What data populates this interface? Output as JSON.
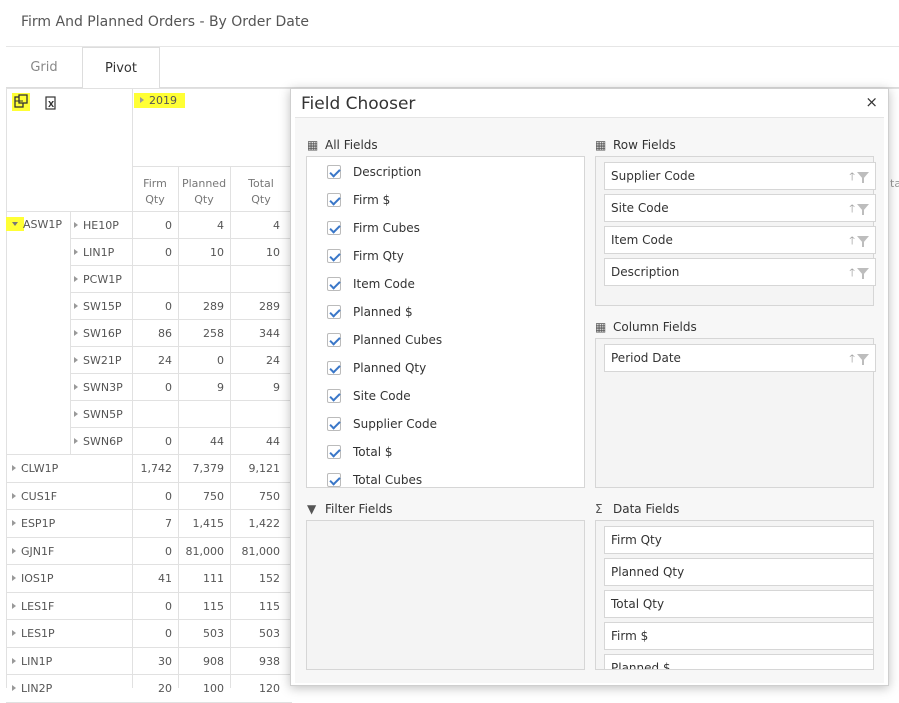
{
  "page": {
    "title": "Firm And Planned Orders - By Order Date"
  },
  "tabs": [
    {
      "label": "Grid"
    },
    {
      "label": "Pivot"
    }
  ],
  "pivot": {
    "year": "2019",
    "col_headers": [
      "Firm\nQty",
      "Planned\nQty",
      "Total\nQty"
    ],
    "col_partial": "ta",
    "group": "ASW1P",
    "sub_rows": [
      {
        "label": "HE10P",
        "firm": "0",
        "planned": "4",
        "total": "4"
      },
      {
        "label": "LIN1P",
        "firm": "0",
        "planned": "10",
        "total": "10"
      },
      {
        "label": "PCW1P",
        "firm": "",
        "planned": "",
        "total": ""
      },
      {
        "label": "SW15P",
        "firm": "0",
        "planned": "289",
        "total": "289"
      },
      {
        "label": "SW16P",
        "firm": "86",
        "planned": "258",
        "total": "344"
      },
      {
        "label": "SW21P",
        "firm": "24",
        "planned": "0",
        "total": "24"
      },
      {
        "label": "SWN3P",
        "firm": "0",
        "planned": "9",
        "total": "9"
      },
      {
        "label": "SWN5P",
        "firm": "",
        "planned": "",
        "total": ""
      },
      {
        "label": "SWN6P",
        "firm": "0",
        "planned": "44",
        "total": "44"
      }
    ],
    "rows": [
      {
        "label": "CLW1P",
        "firm": "1,742",
        "planned": "7,379",
        "total": "9,121"
      },
      {
        "label": "CUS1F",
        "firm": "0",
        "planned": "750",
        "total": "750"
      },
      {
        "label": "ESP1P",
        "firm": "7",
        "planned": "1,415",
        "total": "1,422"
      },
      {
        "label": "GJN1F",
        "firm": "0",
        "planned": "81,000",
        "total": "81,000"
      },
      {
        "label": "IOS1P",
        "firm": "41",
        "planned": "111",
        "total": "152"
      },
      {
        "label": "LES1F",
        "firm": "0",
        "planned": "115",
        "total": "115"
      },
      {
        "label": "LES1P",
        "firm": "0",
        "planned": "503",
        "total": "503"
      },
      {
        "label": "LIN1P",
        "firm": "30",
        "planned": "908",
        "total": "938"
      },
      {
        "label": "LIN2P",
        "firm": "20",
        "planned": "100",
        "total": "120"
      }
    ]
  },
  "dialog": {
    "title": "Field Chooser",
    "close": "×",
    "all_fields_label": "All Fields",
    "all_fields": [
      "Description",
      "Firm $",
      "Firm Cubes",
      "Firm Qty",
      "Item Code",
      "Planned $",
      "Planned Cubes",
      "Planned Qty",
      "Site Code",
      "Supplier Code",
      "Total $",
      "Total Cubes"
    ],
    "row_fields_label": "Row Fields",
    "row_fields": [
      "Supplier Code",
      "Site Code",
      "Item Code",
      "Description"
    ],
    "column_fields_label": "Column Fields",
    "column_fields": [
      "Period Date"
    ],
    "filter_fields_label": "Filter Fields",
    "data_fields_label": "Data Fields",
    "data_fields": [
      "Firm Qty",
      "Planned Qty",
      "Total Qty",
      "Firm $",
      "Planned $"
    ]
  },
  "colors": {
    "highlight": "#ffff35",
    "check": "#3a77c8"
  }
}
